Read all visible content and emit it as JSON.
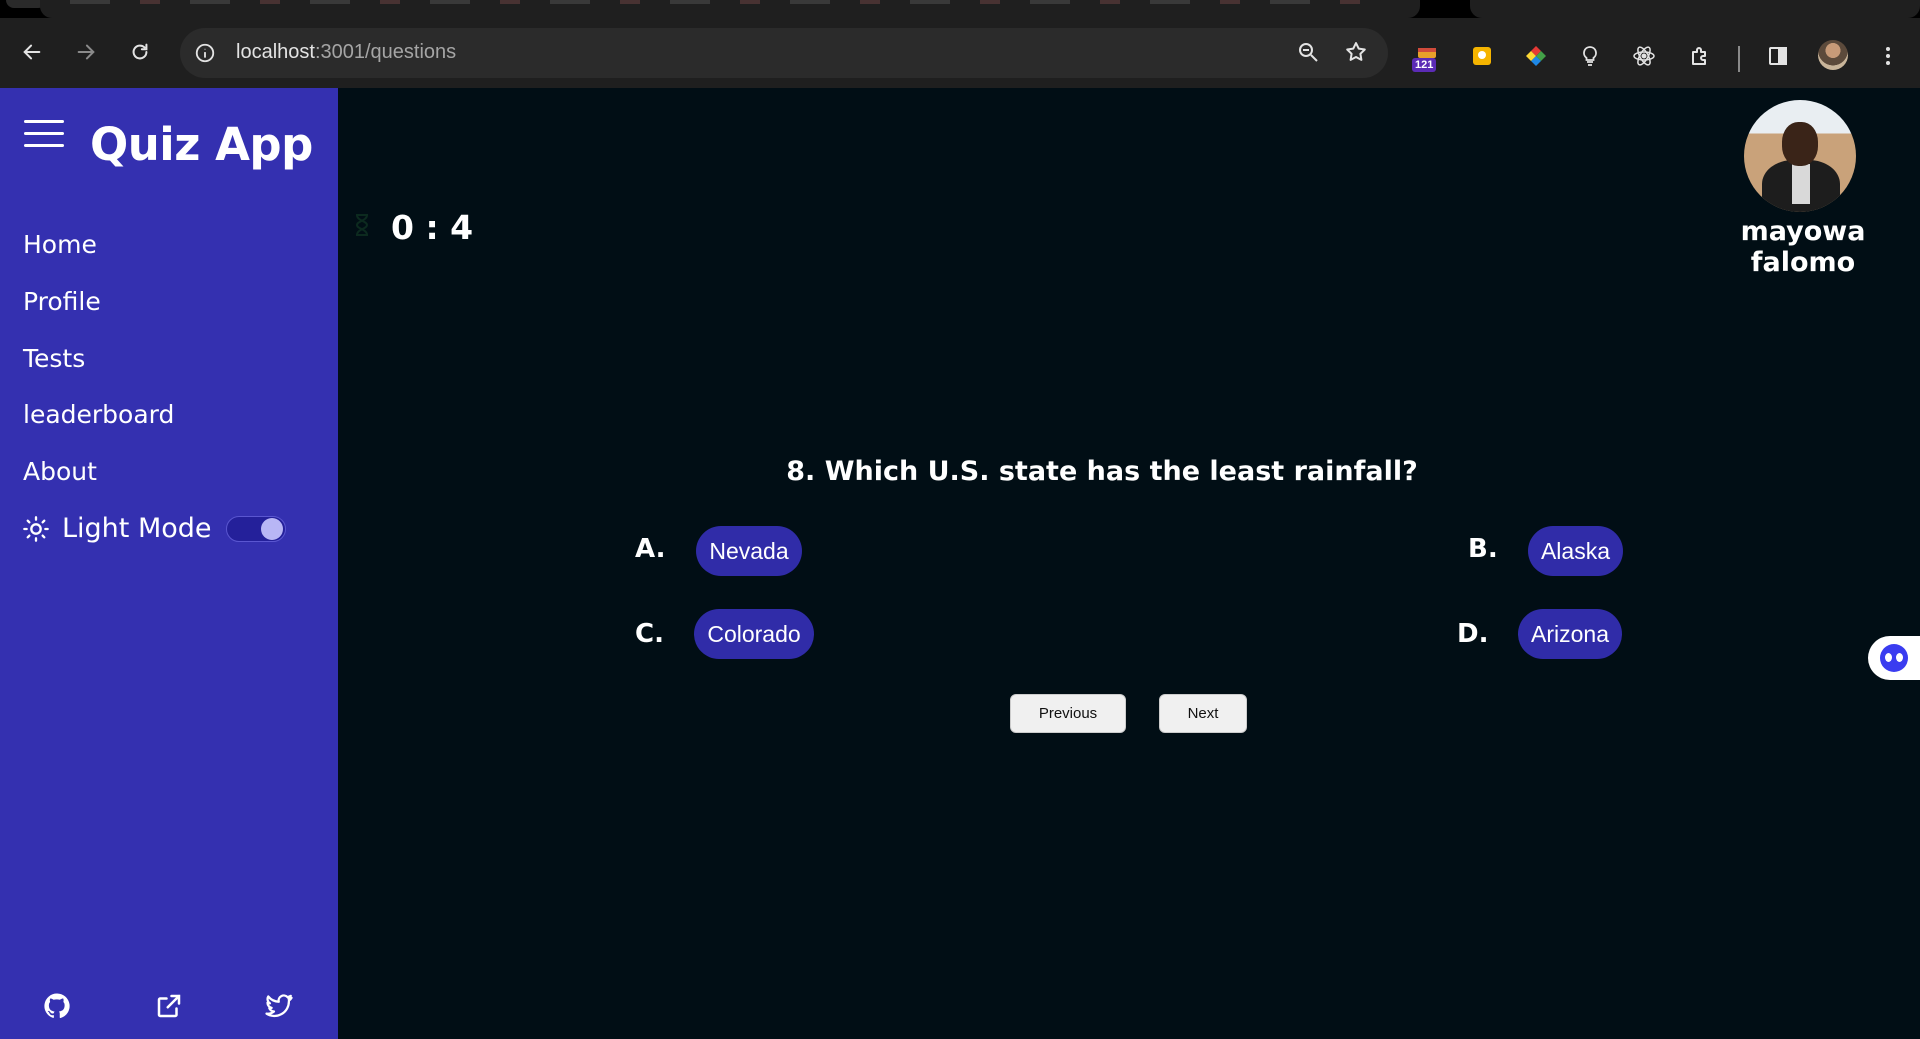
{
  "browser": {
    "url_host": "localhost",
    "url_path": ":3001/questions",
    "extension_badge": "121"
  },
  "sidebar": {
    "brand": "Quiz App",
    "items": [
      {
        "label": "Home"
      },
      {
        "label": "Profile"
      },
      {
        "label": "Tests"
      },
      {
        "label": "leaderboard"
      },
      {
        "label": "About"
      }
    ],
    "mode_label": "Light Mode",
    "mode_on": true
  },
  "header": {
    "timer": "0 : 4",
    "username": "mayowa falomo"
  },
  "quiz": {
    "question": "8. Which U.S. state has the least rainfall?",
    "options": [
      {
        "letter": "A.",
        "text": "Nevada"
      },
      {
        "letter": "B.",
        "text": "Alaska"
      },
      {
        "letter": "C.",
        "text": "Colorado"
      },
      {
        "letter": "D.",
        "text": "Arizona"
      }
    ],
    "previous_label": "Previous",
    "next_label": "Next"
  },
  "colors": {
    "sidebar_bg": "#3430b0",
    "main_bg": "#010e15",
    "option_bg": "#302ca8"
  }
}
